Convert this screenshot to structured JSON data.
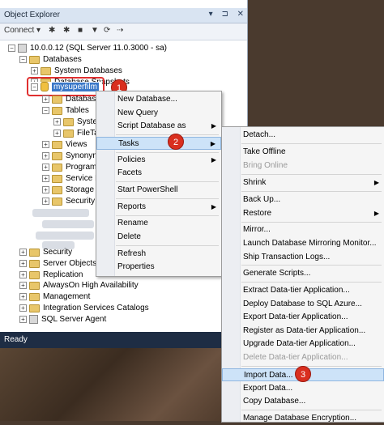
{
  "object_explorer": {
    "title": "Object Explorer",
    "title_buttons": [
      "▾",
      "⊐",
      "✕"
    ],
    "toolbar": {
      "connect": "Connect ▾",
      "icons": [
        "✱",
        "✱",
        "■",
        "▼",
        "⟳",
        "⇢"
      ]
    },
    "tree": {
      "server": "10.0.0.12 (SQL Server 11.0.3000 - sa)",
      "databases": "Databases",
      "system_databases": "System Databases",
      "database_snapshots": "Database Snapshots",
      "selected_db": "mysuperfilm",
      "db_children": [
        "Databases",
        "Tables",
        "System",
        "FileTa",
        "Views",
        "Synonym",
        "Program",
        "Service B",
        "Storage",
        "Security"
      ],
      "server_children": [
        "Security",
        "Server Objects",
        "Replication",
        "AlwaysOn High Availability",
        "Management",
        "Integration Services Catalogs",
        "SQL Server Agent"
      ]
    }
  },
  "status_bar": {
    "text": "Ready"
  },
  "badges": [
    "1",
    "2",
    "3"
  ],
  "context_menu": {
    "items": [
      "New Database...",
      "New Query",
      "Script Database as",
      "Tasks",
      "Policies",
      "Facets",
      "Start PowerShell",
      "Reports",
      "Rename",
      "Delete",
      "Refresh",
      "Properties"
    ]
  },
  "tasks_menu": {
    "items": [
      "Detach...",
      "Take Offline",
      "Bring Online",
      "Shrink",
      "Back Up...",
      "Restore",
      "Mirror...",
      "Launch Database Mirroring Monitor...",
      "Ship Transaction Logs...",
      "Generate Scripts...",
      "Extract Data-tier Application...",
      "Deploy Database to SQL Azure...",
      "Export Data-tier Application...",
      "Register as Data-tier Application...",
      "Upgrade Data-tier Application...",
      "Delete Data-tier Application...",
      "Import Data...",
      "Export Data...",
      "Copy Database...",
      "Manage Database Encryption..."
    ]
  },
  "colors": {
    "accent_red": "#d92f1f",
    "selection_blue": "#3a78c8",
    "title_bar": "#d9e4f2"
  }
}
